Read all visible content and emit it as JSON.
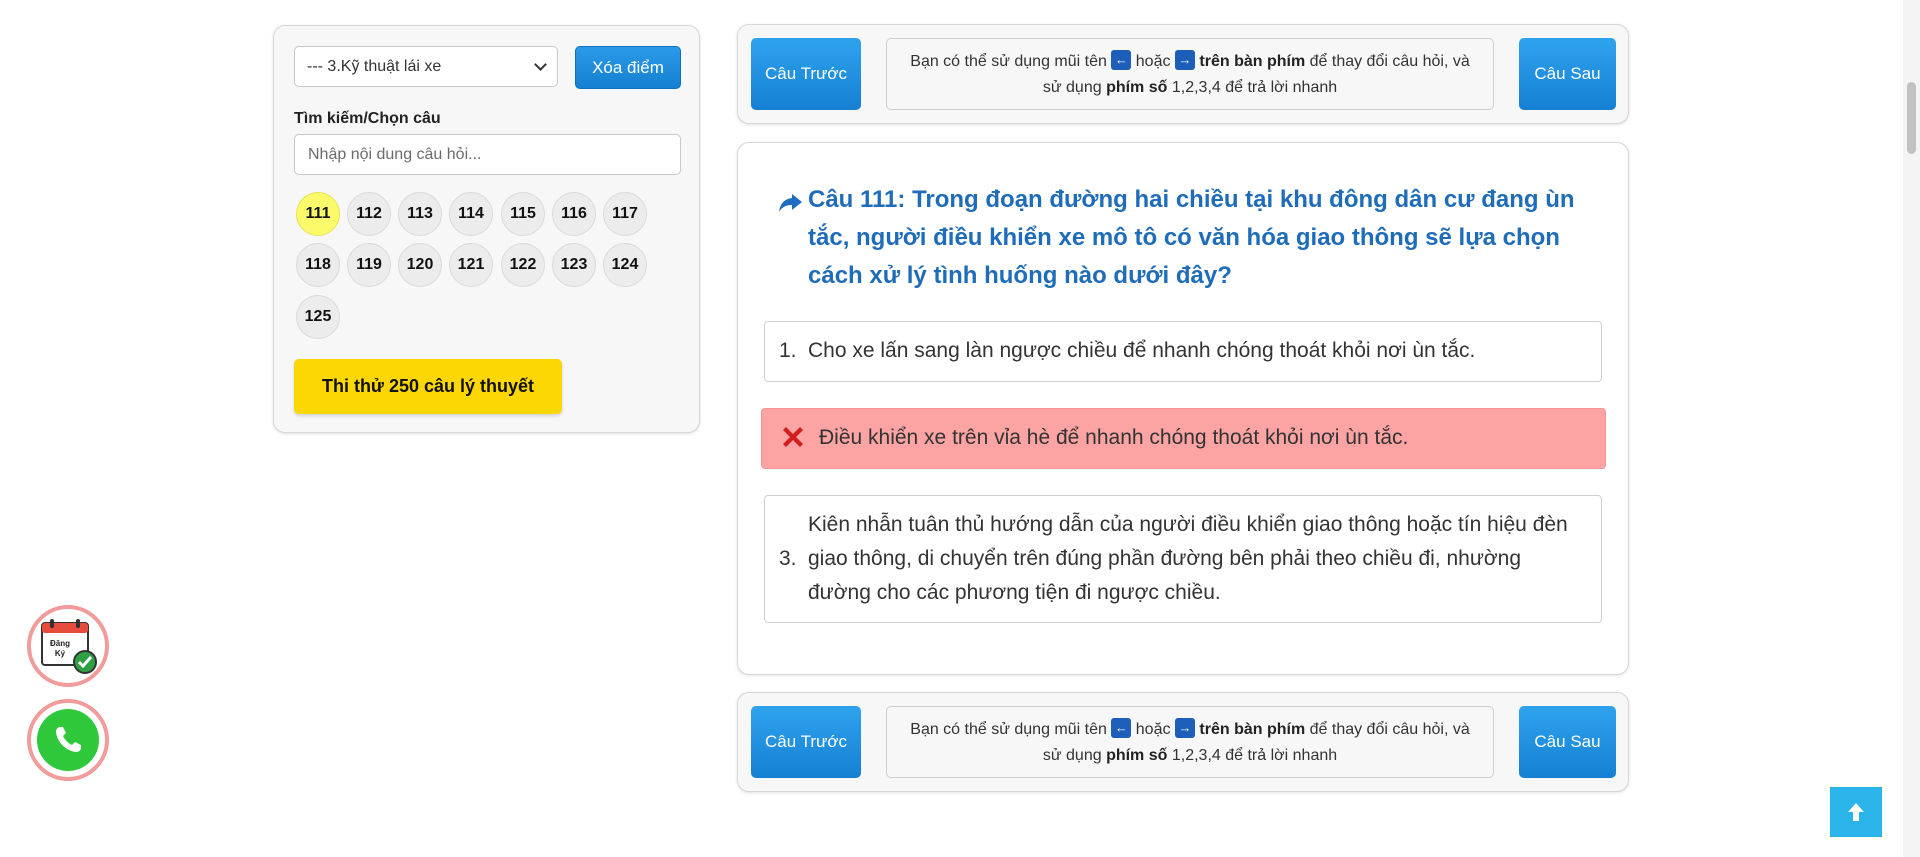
{
  "left_panel": {
    "category_select": "--- 3.Kỹ thuật lái xe",
    "clear_button": "Xóa điểm",
    "search_label": "Tìm kiếm/Chọn câu",
    "search_placeholder": "Nhập nội dung câu hỏi...",
    "question_numbers": [
      "111",
      "112",
      "113",
      "114",
      "115",
      "116",
      "117",
      "118",
      "119",
      "120",
      "121",
      "122",
      "123",
      "124",
      "125"
    ],
    "active_question": "111",
    "test_button": "Thi thử 250 câu lý thuyết"
  },
  "nav_top": {
    "prev": "Câu Trước",
    "next": "Câu Sau",
    "hint_1": "Bạn có thể sử dụng mũi tên",
    "hint_or": "hoặc",
    "hint_keyboard": "trên bàn phím",
    "hint_2": "để thay đổi câu hỏi, và",
    "hint_3": "sử dụng",
    "hint_numkeys": "phím số",
    "hint_4": "1,2,3,4 để trả lời nhanh",
    "left_key": "←",
    "right_key": "→"
  },
  "nav_bottom": {
    "prev": "Câu Trước",
    "next": "Câu Sau",
    "hint_1": "Bạn có thể sử dụng mũi tên",
    "hint_or": "hoặc",
    "hint_keyboard": "trên bàn phím",
    "hint_2": "để thay đổi câu hỏi, và",
    "hint_3": "sử dụng",
    "hint_numkeys": "phím số",
    "hint_4": "1,2,3,4 để trả lời nhanh",
    "left_key": "←",
    "right_key": "→"
  },
  "question": {
    "title": "Câu 111: Trong đoạn đường hai chiều tại khu đông dân cư đang ùn tắc, người điều khiển xe mô tô có văn hóa giao thông sẽ lựa chọn cách xử lý tình huống nào dưới đây?",
    "answers": [
      {
        "num": "1.",
        "text": "Cho xe lấn sang làn ngược chiều để nhanh chóng thoát khỏi nơi ùn tắc.",
        "state": "normal"
      },
      {
        "num": "",
        "text": "Điều khiển xe trên vỉa hè để nhanh chóng thoát khỏi nơi ùn tắc.",
        "state": "wrong"
      },
      {
        "num": "3.",
        "text": "Kiên nhẫn tuân thủ hướng dẫn của người điều khiển giao thông hoặc tín hiệu đèn giao thông, di chuyển trên đúng phần đường bên phải theo chiều đi, nhường đường cho các phương tiện đi ngược chiều.",
        "state": "normal"
      }
    ]
  },
  "floating": {
    "register_label": "Đăng Ký",
    "register_icon": "calendar-check-icon",
    "phone_icon": "phone-icon",
    "scroll_top_icon": "arrow-up-icon"
  },
  "colors": {
    "primary_blue": "#1c82d3",
    "title_blue": "#1f6cb8",
    "wrong_bg": "#fca3a3",
    "active_num": "#fafa6a",
    "test_button": "#fcd703",
    "phone_green": "#2fc83b"
  }
}
